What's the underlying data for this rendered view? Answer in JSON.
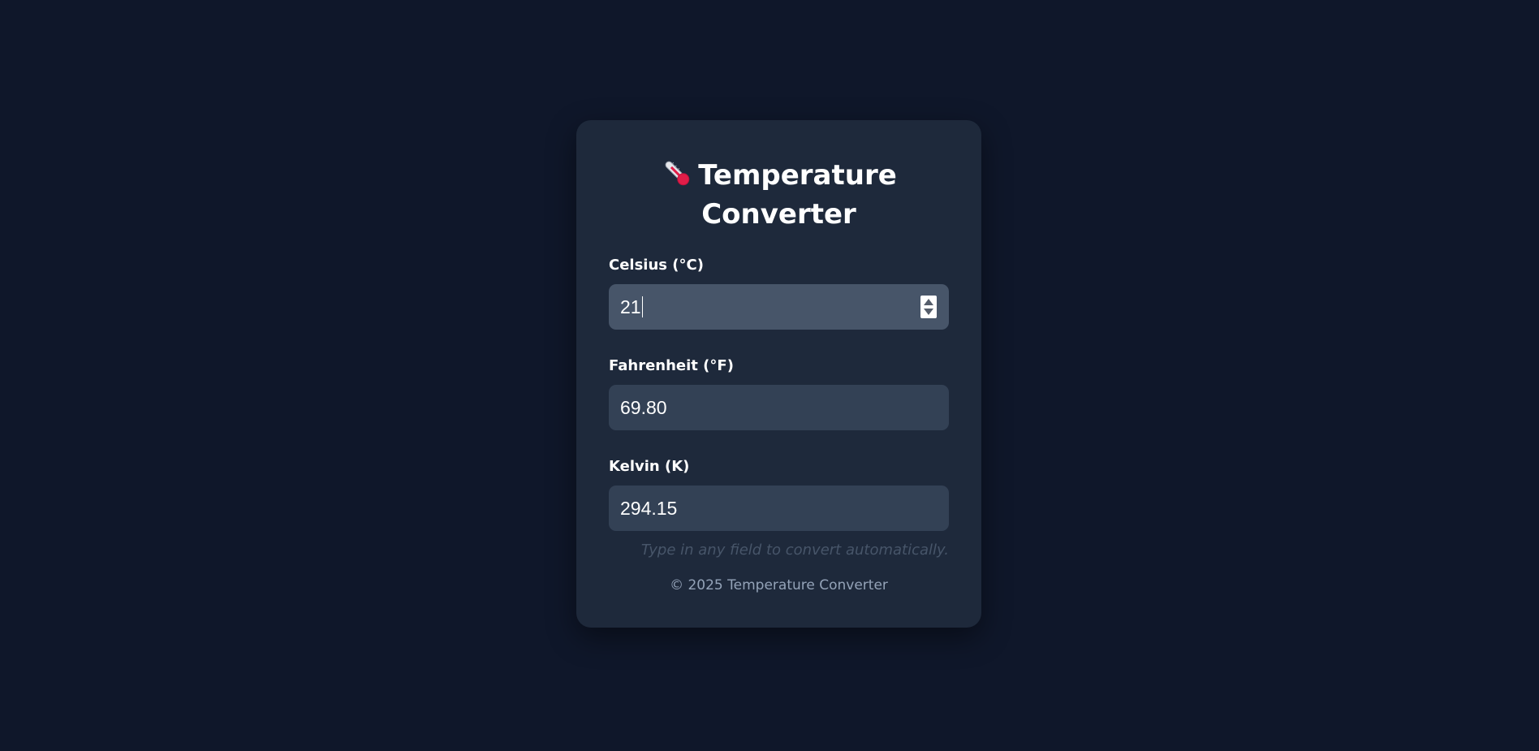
{
  "app": {
    "title_line1": "Temperature",
    "title_line2": "Converter",
    "title_icon": "thermometer-icon"
  },
  "fields": [
    {
      "label": "Celsius (°C)",
      "value": "21"
    },
    {
      "label": "Fahrenheit (°F)",
      "value": "69.80"
    },
    {
      "label": "Kelvin (K)",
      "value": "294.15"
    }
  ],
  "hint": "Type in any field to convert automatically.",
  "footer": "© 2025 Temperature Converter",
  "colors": {
    "background": "#0f172a",
    "card": "#1e293b",
    "input": "#334155",
    "input_active": "#475569",
    "thermometer_accent": "#e11d48"
  }
}
